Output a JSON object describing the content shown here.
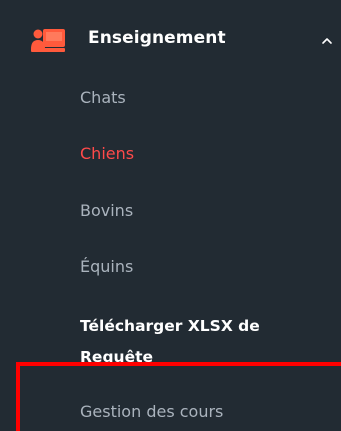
{
  "sidebar": {
    "section": {
      "title": "Enseignement",
      "icon": "teaching-board-icon",
      "chevron": "chevron-up-icon",
      "accent_color": "#ff5a3c"
    },
    "items": [
      {
        "label": "Chats",
        "state": "default"
      },
      {
        "label": "Chiens",
        "state": "active"
      },
      {
        "label": "Bovins",
        "state": "default"
      },
      {
        "label": "Équins",
        "state": "default"
      },
      {
        "label": "Télécharger XLSX de Requête",
        "state": "bold"
      },
      {
        "label": "Gestion des cours",
        "state": "highlighted"
      }
    ]
  },
  "colors": {
    "background": "#222b33",
    "text_default": "#aab3bd",
    "text_active": "#ff4a4a",
    "text_bold": "#ffffff",
    "highlight_border": "#ff0000"
  }
}
